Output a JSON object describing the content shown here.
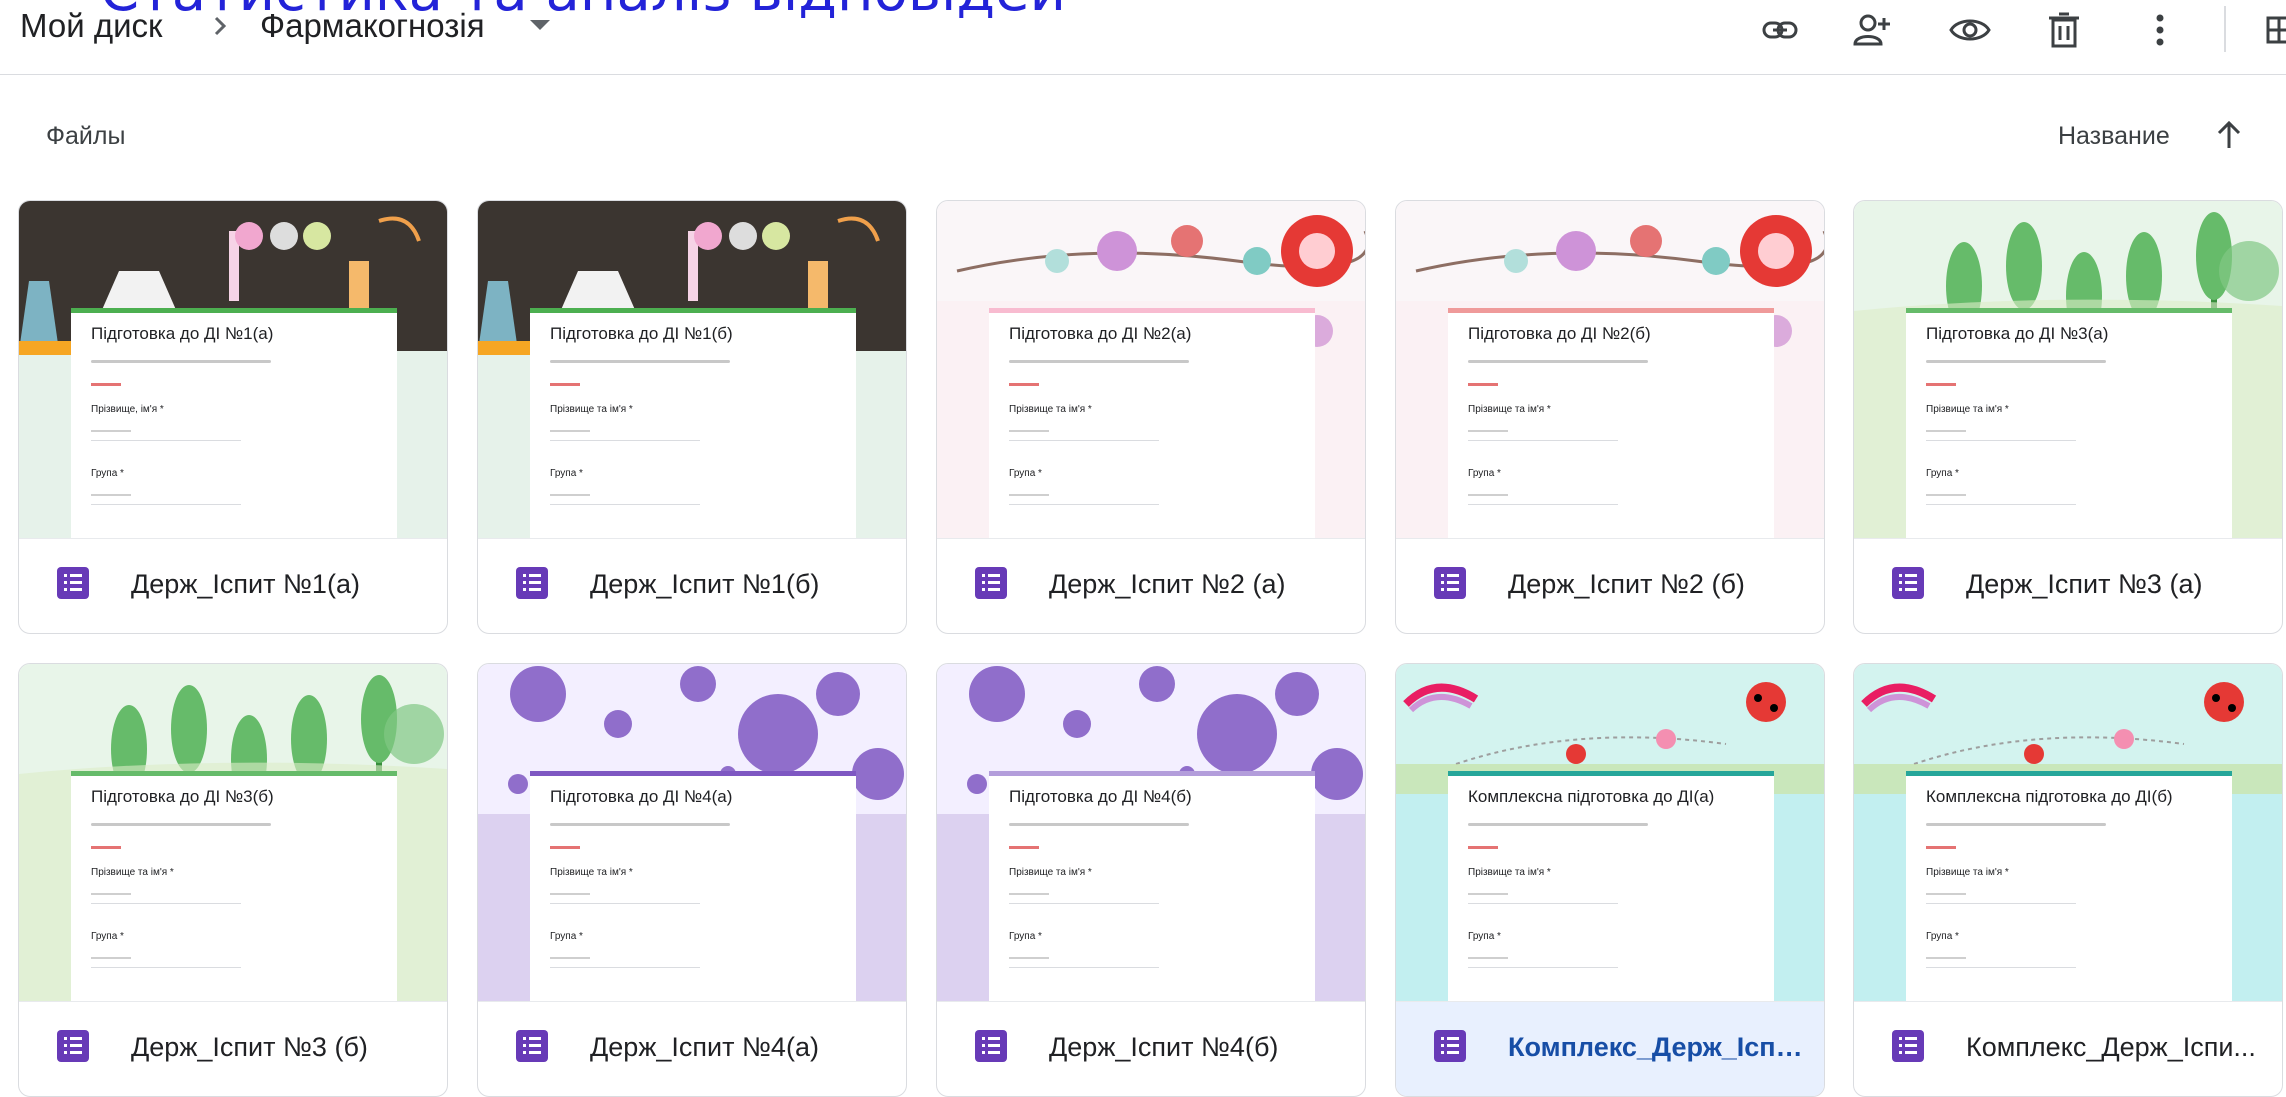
{
  "overlay_title": "Статистика та аналіз відповідей",
  "breadcrumb": {
    "root": "Мой диск",
    "current": "Фармакогнозія"
  },
  "toolbar": {
    "icons": [
      "link-icon",
      "add-person-icon",
      "preview-eye-icon",
      "trash-icon",
      "more-vert-icon",
      "grid-view-icon"
    ]
  },
  "section": {
    "label": "Файлы"
  },
  "sort": {
    "label": "Название",
    "direction": "ascending"
  },
  "files": [
    {
      "name": "Держ_Іспит №1(а)",
      "form_title": "Підготовка до ДІ №1(а)",
      "field1": "Прізвище, ім'я *",
      "field2": "Група *",
      "theme": "lab",
      "accent": "#4caf50"
    },
    {
      "name": "Держ_Іспит №1(б)",
      "form_title": "Підготовка до ДІ №1(б)",
      "field1": "Прізвище та ім'я *",
      "field2": "Група *",
      "theme": "lab",
      "accent": "#4caf50"
    },
    {
      "name": "Держ_Іспит №2 (а)",
      "form_title": "Підготовка до ДІ №2(а)",
      "field1": "Прізвище та ім'я *",
      "field2": "Група *",
      "theme": "flowers",
      "accent": "#f8bbd0"
    },
    {
      "name": "Держ_Іспит №2 (б)",
      "form_title": "Підготовка до ДІ №2(б)",
      "field1": "Прізвище та ім'я *",
      "field2": "Група *",
      "theme": "flowers",
      "accent": "#ef9a9a"
    },
    {
      "name": "Держ_Іспит №3 (а)",
      "form_title": "Підготовка до ДІ №3(а)",
      "field1": "Прізвище та ім'я *",
      "field2": "Група *",
      "theme": "trees",
      "accent": "#66bb6a"
    },
    {
      "name": "Держ_Іспит №3 (б)",
      "form_title": "Підготовка до ДІ №3(б)",
      "field1": "Прізвище та ім'я *",
      "field2": "Група *",
      "theme": "trees",
      "accent": "#66bb6a"
    },
    {
      "name": "Держ_Іспит №4(а)",
      "form_title": "Підготовка до ДІ №4(а)",
      "field1": "Прізвище та ім'я *",
      "field2": "Група *",
      "theme": "bubbles",
      "accent": "#7e57c2"
    },
    {
      "name": "Держ_Іспит №4(б)",
      "form_title": "Підготовка до ДІ №4(б)",
      "field1": "Прізвище та ім'я *",
      "field2": "Група *",
      "theme": "bubbles",
      "accent": "#b39ddb"
    },
    {
      "name": "Комплекс_Держ_Іспи...",
      "form_title": "Комплексна підготовка до ДІ(а)",
      "field1": "Прізвище та ім'я *",
      "field2": "Група *",
      "theme": "ladybug",
      "accent": "#26a69a",
      "selected": true
    },
    {
      "name": "Комплекс_Держ_Іспи...",
      "form_title": "Комплексна підготовка до ДІ(б)",
      "field1": "Прізвище та ім'я *",
      "field2": "Група *",
      "theme": "ladybug",
      "accent": "#26a69a"
    }
  ]
}
